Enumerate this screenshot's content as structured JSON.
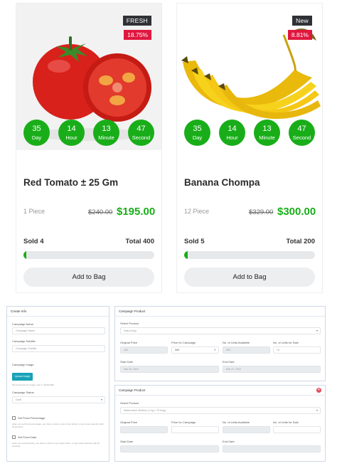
{
  "products": [
    {
      "badge": "FRESH",
      "discount": "18.75%",
      "timer": [
        {
          "value": "35",
          "unit": "Day"
        },
        {
          "value": "14",
          "unit": "Hour"
        },
        {
          "value": "13",
          "unit": "Minute"
        },
        {
          "value": "47",
          "unit": "Second"
        }
      ],
      "name": "Red Tomato ± 25 Gm",
      "quantity": "1 Piece",
      "old_price": "$240.00",
      "price": "$195.00",
      "sold": "Sold 4",
      "total": "Total 400",
      "sold_progress": 0.01,
      "button": "Add to Bag"
    },
    {
      "badge": "New",
      "discount": "8.81%",
      "timer": [
        {
          "value": "35",
          "unit": "Day"
        },
        {
          "value": "14",
          "unit": "Hour"
        },
        {
          "value": "13",
          "unit": "Minute"
        },
        {
          "value": "47",
          "unit": "Second"
        }
      ],
      "name": "Banana Chompa",
      "quantity": "12 Piece",
      "old_price": "$329.00",
      "price": "$300.00",
      "sold": "Sold 5",
      "total": "Total 200",
      "sold_progress": 0.025,
      "button": "Add to Bag"
    }
  ],
  "colors": {
    "accent_green": "#19ae19",
    "badge_red": "#e0173f",
    "badge_dark": "#2f3136"
  },
  "create_info": {
    "title": "Create Info",
    "name_label": "Campaign Name",
    "name_placeholder": "Campaign Name",
    "subtitle_label": "Campaign Subtitle",
    "subtitle_placeholder": "Campaign Subtitle",
    "image_label": "Campaign Image",
    "upload_button": "Upload Image",
    "image_note": "Min dimension for image: size 4: 1920x1080",
    "status_label": "Campaign Status",
    "status_value": "Draft",
    "fixed_pct_label": "Set Fixed Percentage",
    "fixed_pct_note": "when you set fixed percentage, you have to click on sync price button to sync price selection with all products",
    "fixed_date_label": "Set Fixed Date",
    "fixed_date_note": "when you set fixed date, you have to click on sync date button, to sync date selection with all products"
  },
  "campaign_products": [
    {
      "title": "Campaign Product",
      "select_label": "Select Product",
      "select_value": "Dairy living",
      "original_price_label": "Original Price",
      "original_price": "420",
      "price_for_campaign_label": "Price for Campaign",
      "price_for_campaign": "343",
      "units_available_label": "No. of Units Available",
      "units_available": "549",
      "units_for_sale_label": "No. of Units for Sale",
      "units_for_sale": "10",
      "start_date_label": "Start Date",
      "start_date": "Mar 24, 2022",
      "end_date_label": "End Date",
      "end_date": "Mar 27, 2022"
    },
    {
      "title": "Campaign Product",
      "select_label": "Select Product",
      "select_value": "Watermelon Medium (1 kg ± 75 kmg)",
      "original_price_label": "Original Price",
      "original_price": "",
      "price_for_campaign_label": "Price for Campaign",
      "price_for_campaign": "",
      "units_available_label": "No. of Units Available",
      "units_available": "",
      "units_for_sale_label": "No. of Units for Sale",
      "units_for_sale": "",
      "start_date_label": "Start Date",
      "start_date": "",
      "end_date_label": "End Date",
      "end_date": ""
    }
  ]
}
